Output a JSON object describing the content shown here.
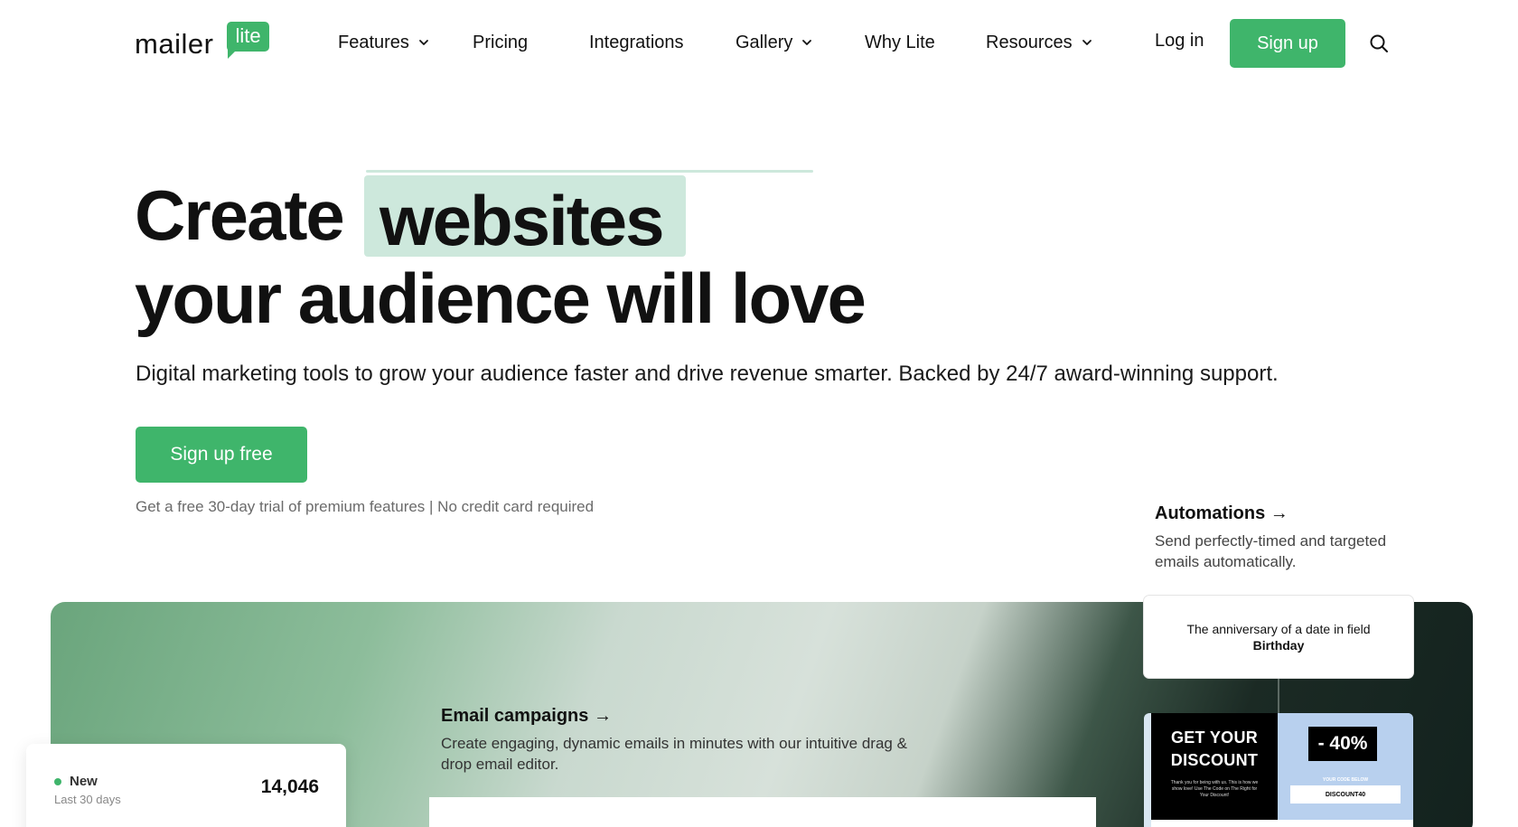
{
  "brand": {
    "word": "mailer",
    "bubble": "lite",
    "accent_color": "#3fb56b",
    "highlight_color": "#cde8dc"
  },
  "nav": {
    "items": [
      {
        "label": "Features",
        "has_dropdown": true
      },
      {
        "label": "Pricing",
        "has_dropdown": false
      },
      {
        "label": "Integrations",
        "has_dropdown": false
      },
      {
        "label": "Gallery",
        "has_dropdown": true
      },
      {
        "label": "Why Lite",
        "has_dropdown": false
      },
      {
        "label": "Resources",
        "has_dropdown": true
      }
    ],
    "login_label": "Log in",
    "signup_label": "Sign up",
    "search_icon": "search-icon"
  },
  "hero": {
    "word_create": "Create",
    "word_highlight": "websites",
    "line2": "your audience will love",
    "subtitle": "Digital marketing tools to grow your audience faster and drive revenue smarter. Backed by 24/7 award-winning support.",
    "cta_label": "Sign up free",
    "trial_note": "Get a free 30-day trial of premium features | No credit card required"
  },
  "automations": {
    "title": "Automations →",
    "description": "Send perfectly-timed and targeted emails automatically."
  },
  "email_campaigns": {
    "title": "Email campaigns →",
    "description": "Create engaging, dynamic emails in minutes with our intuitive drag & drop email editor."
  },
  "stat_card": {
    "label": "New",
    "sublabel": "Last 30 days",
    "value": "14,046"
  },
  "trigger_card": {
    "text_prefix": "The anniversary of a date in field ",
    "field_name": "Birthday"
  },
  "promo": {
    "heading_line1": "GET YOUR",
    "heading_line2": "DISCOUNT",
    "small_text": "Thank you for being with us. This is how we show love! Use The Code on The Right for Your Discount!",
    "badge": "- 40%",
    "code_label": "YOUR CODE BELOW",
    "code": "DISCOUNT40"
  }
}
